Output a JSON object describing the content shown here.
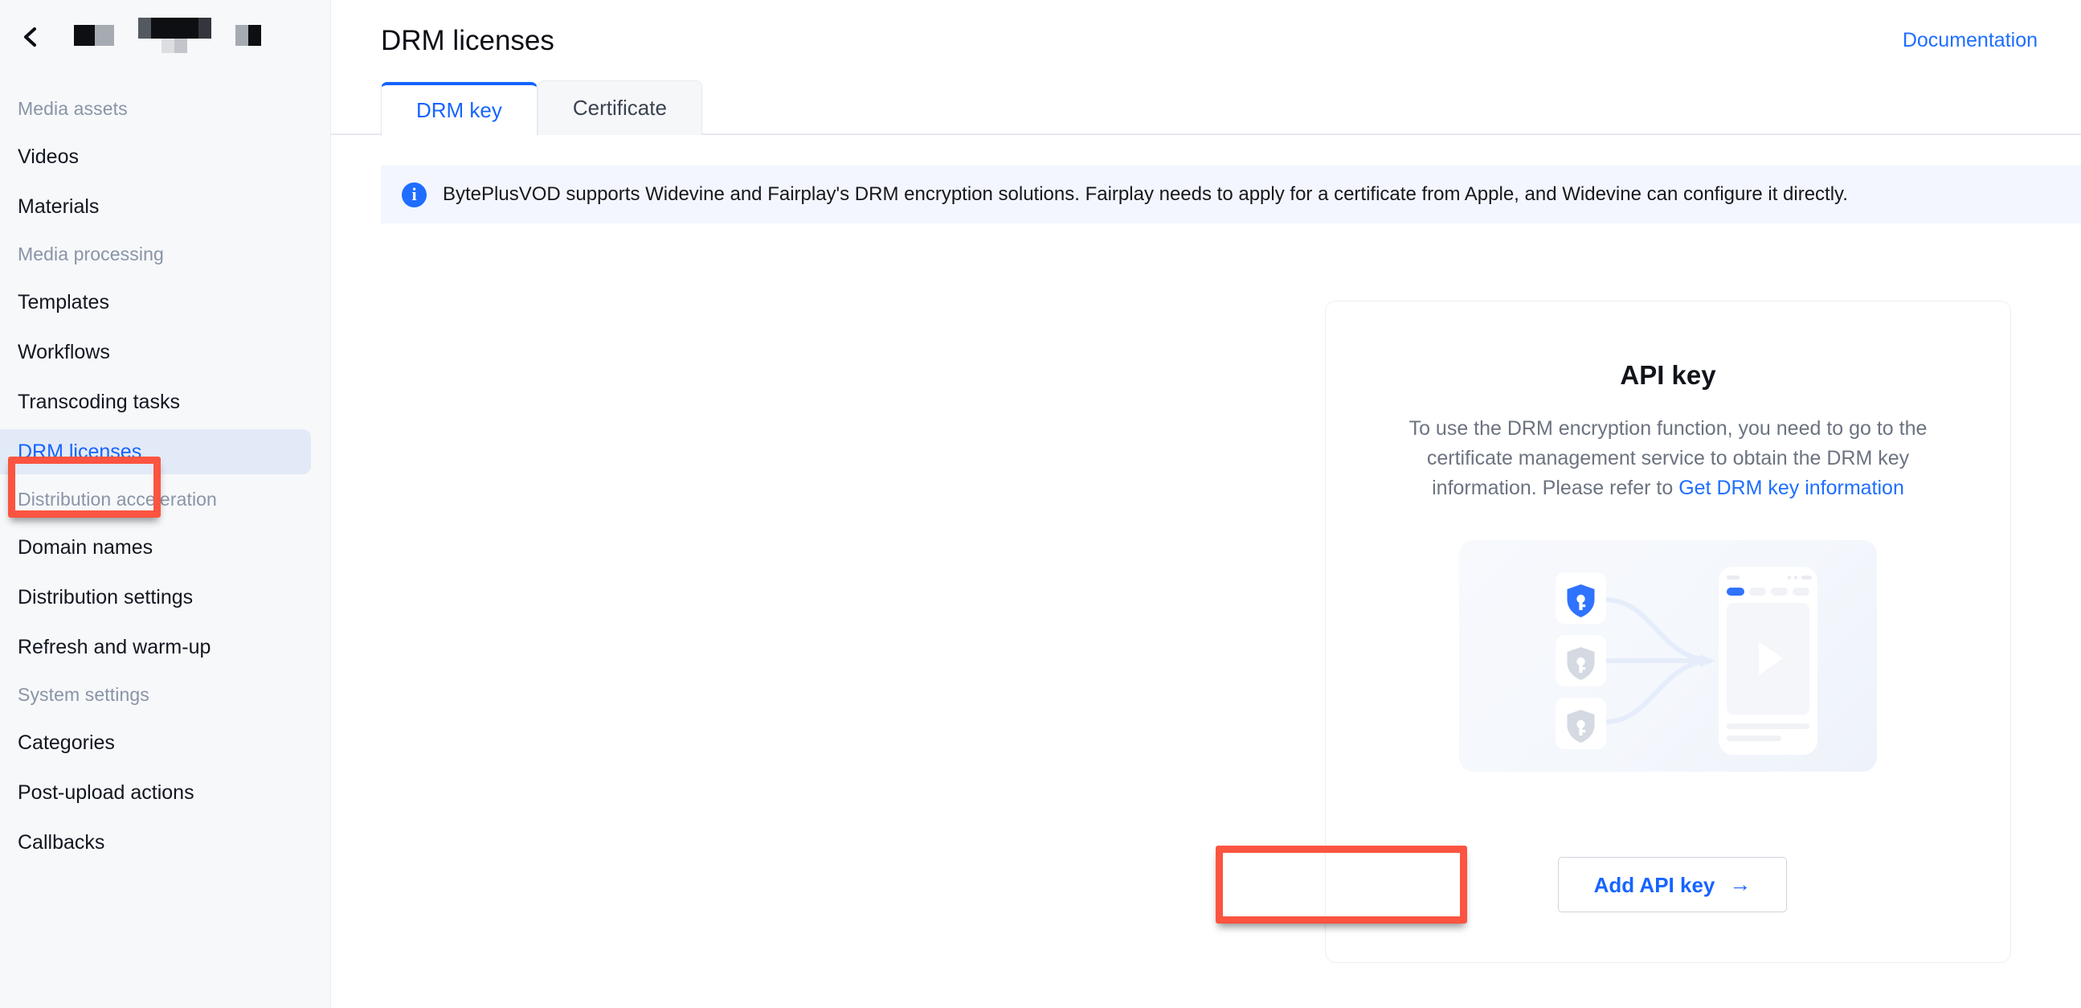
{
  "sidebar": {
    "back_icon": "chevron-left-icon",
    "title_redacted": true,
    "groups": [
      {
        "label": "Media assets",
        "items": [
          {
            "label": "Videos",
            "active": false
          },
          {
            "label": "Materials",
            "active": false
          }
        ]
      },
      {
        "label": "Media processing",
        "items": [
          {
            "label": "Templates",
            "active": false
          },
          {
            "label": "Workflows",
            "active": false
          },
          {
            "label": "Transcoding tasks",
            "active": false
          },
          {
            "label": "DRM licenses",
            "active": true
          }
        ]
      },
      {
        "label": "Distribution acceleration",
        "items": [
          {
            "label": "Domain names",
            "active": false
          },
          {
            "label": "Distribution settings",
            "active": false
          },
          {
            "label": "Refresh and warm-up",
            "active": false
          }
        ]
      },
      {
        "label": "System settings",
        "items": [
          {
            "label": "Categories",
            "active": false
          },
          {
            "label": "Post-upload actions",
            "active": false
          },
          {
            "label": "Callbacks",
            "active": false
          }
        ]
      }
    ]
  },
  "header": {
    "title": "DRM licenses",
    "documentation_label": "Documentation"
  },
  "tabs": [
    {
      "label": "DRM key",
      "active": true
    },
    {
      "label": "Certificate",
      "active": false
    }
  ],
  "banner": {
    "icon": "info-circle-icon",
    "text": "BytePlusVOD supports Widevine and Fairplay's DRM encryption solutions. Fairplay needs to apply for a certificate from Apple, and Widevine can configure it directly."
  },
  "card": {
    "title": "API key",
    "description_before_link": "To use the DRM encryption function, you need to go to the certificate management service to obtain the DRM key information. Please refer to ",
    "link_label": "Get DRM key information",
    "illustration": "drm-keys-to-player-illustration"
  },
  "add_button": {
    "label": "Add API key",
    "arrow_icon": "arrow-right-icon"
  },
  "annotations": [
    {
      "name": "sidebar-drm-licenses-highlight",
      "color": "#fb5440"
    },
    {
      "name": "add-api-key-highlight",
      "color": "#fb5440"
    }
  ],
  "colors": {
    "accent_blue": "#1664ff",
    "link_blue": "#1f6eff",
    "annotation_red": "#fb5440",
    "sidebar_bg": "#f6f8fa",
    "active_item_bg": "#e3eaf7",
    "banner_bg": "#f3f6fe"
  }
}
